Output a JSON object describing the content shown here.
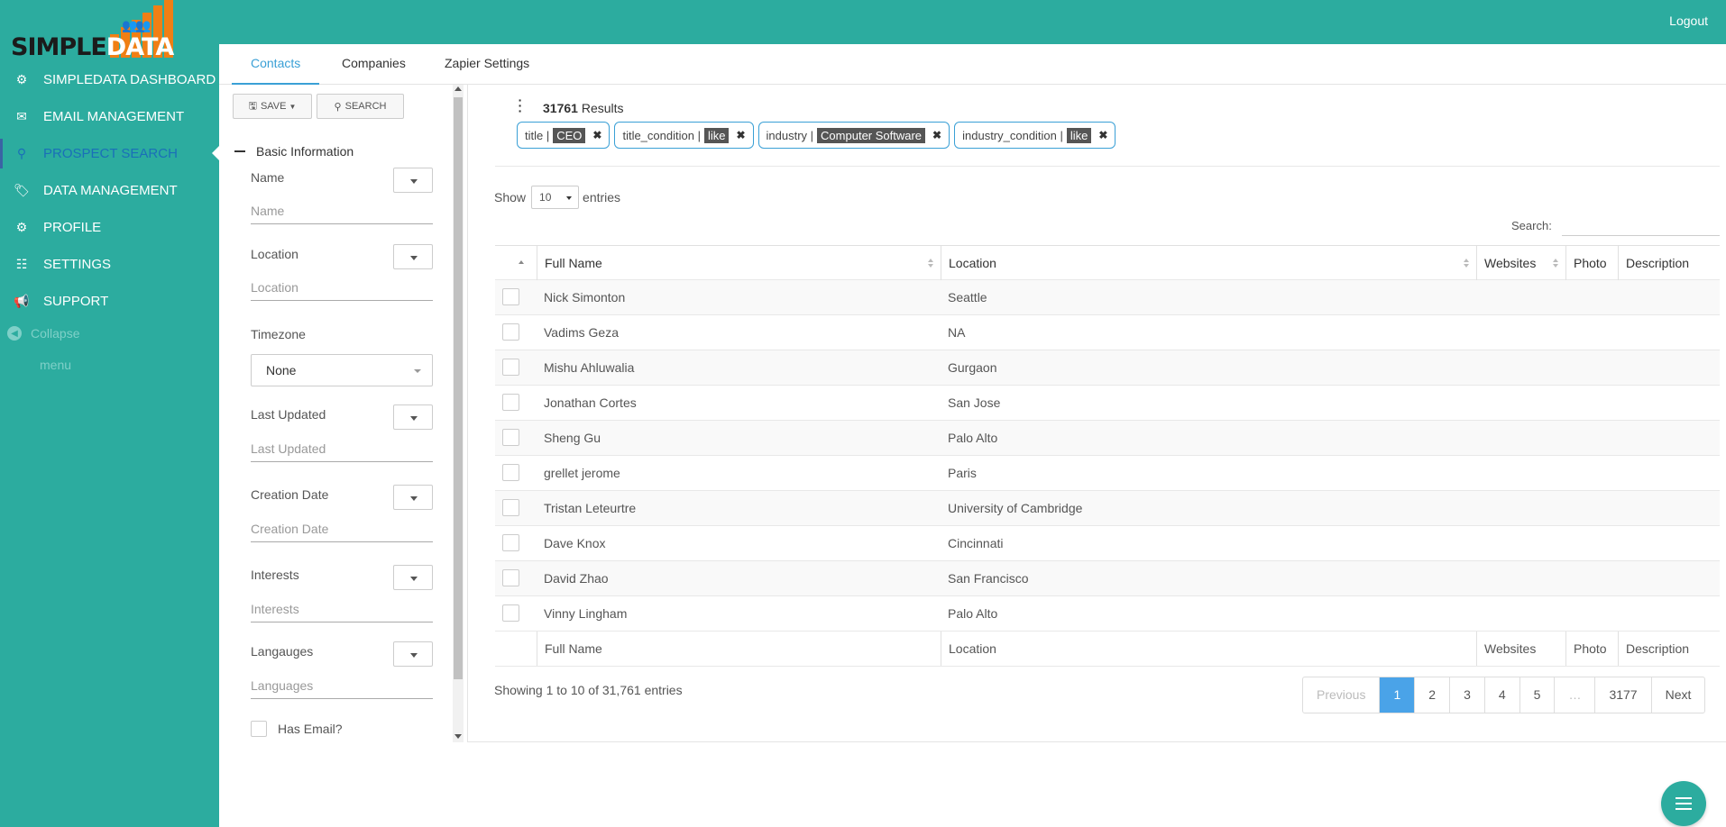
{
  "app": {
    "logo_left": "SIMPLE",
    "logo_right": "DATA",
    "logout": "Logout"
  },
  "sidebar": {
    "items": [
      {
        "label": "SIMPLEDATA DASHBOARD",
        "icon": "gear-icon"
      },
      {
        "label": "EMAIL MANAGEMENT",
        "icon": "envelope-icon"
      },
      {
        "label": "PROSPECT SEARCH",
        "icon": "search-icon"
      },
      {
        "label": "DATA MANAGEMENT",
        "icon": "tag-icon"
      },
      {
        "label": "PROFILE",
        "icon": "gear-icon"
      },
      {
        "label": "SETTINGS",
        "icon": "sliders-icon"
      },
      {
        "label": "SUPPORT",
        "icon": "bullhorn-icon"
      }
    ],
    "active_index": 2,
    "collapse": "Collapse",
    "collapse_sub": "menu"
  },
  "tabs": [
    "Contacts",
    "Companies",
    "Zapier Settings"
  ],
  "filter": {
    "save": "SAVE",
    "search": "SEARCH",
    "section_title": "Basic Information",
    "name_label": "Name",
    "name_placeholder": "Name",
    "location_label": "Location",
    "location_placeholder": "Location",
    "timezone_label": "Timezone",
    "timezone_value": "None",
    "last_updated_label": "Last Updated",
    "last_updated_placeholder": "Last Updated",
    "creation_date_label": "Creation Date",
    "creation_date_placeholder": "Creation Date",
    "interests_label": "Interests",
    "interests_placeholder": "Interests",
    "languages_label": "Langauges",
    "languages_placeholder": "Languages",
    "has_email": "Has Email?"
  },
  "results": {
    "count": "31761",
    "label": "Results",
    "chips": [
      {
        "key": "title |",
        "value": "CEO"
      },
      {
        "key": "title_condition |",
        "value": "like"
      },
      {
        "key": "industry |",
        "value": "Computer Software"
      },
      {
        "key": "industry_condition |",
        "value": "like"
      }
    ]
  },
  "table": {
    "show_label": "Show",
    "entries_value": "10",
    "entries_label": "entries",
    "search_label": "Search:",
    "columns": [
      "Full Name",
      "Location",
      "Websites",
      "Photo",
      "Description"
    ],
    "rows": [
      {
        "name": "Nick Simonton",
        "location": "Seattle"
      },
      {
        "name": "Vadims Geza",
        "location": "NA"
      },
      {
        "name": "Mishu Ahluwalia",
        "location": "Gurgaon"
      },
      {
        "name": "Jonathan Cortes",
        "location": "San Jose"
      },
      {
        "name": "Sheng Gu",
        "location": "Palo Alto"
      },
      {
        "name": "grellet jerome",
        "location": "Paris"
      },
      {
        "name": "Tristan Leteurtre",
        "location": "University of Cambridge"
      },
      {
        "name": "Dave Knox",
        "location": "Cincinnati"
      },
      {
        "name": "David Zhao",
        "location": "San Francisco"
      },
      {
        "name": "Vinny Lingham",
        "location": "Palo Alto"
      }
    ],
    "showing": "Showing 1 to 10 of 31,761 entries",
    "pagination": [
      "Previous",
      "1",
      "2",
      "3",
      "4",
      "5",
      "…",
      "3177",
      "Next"
    ],
    "active_page": "1"
  },
  "colors": {
    "brand": "#2cac9f",
    "accent": "#3aa0d6",
    "logo_orange": "#f07f14",
    "active_page": "#4aa3e8"
  }
}
